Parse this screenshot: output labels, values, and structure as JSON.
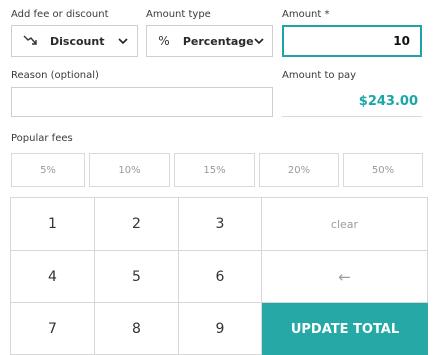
{
  "form": {
    "type_label": "Add fee or discount",
    "type_value": "Discount",
    "amount_type_label": "Amount type",
    "amount_type_value": "Percentage",
    "amount_type_symbol": "%",
    "amount_label": "Amount *",
    "amount_value": "10",
    "reason_label": "Reason (optional)",
    "reason_value": "",
    "amount_to_pay_label": "Amount to pay",
    "amount_to_pay_value": "$243.00"
  },
  "popular_fees": {
    "label": "Popular fees",
    "options": [
      "5%",
      "10%",
      "15%",
      "20%",
      "50%"
    ]
  },
  "keypad": {
    "keys": [
      "1",
      "2",
      "3",
      "4",
      "5",
      "6",
      "7",
      "8",
      "9"
    ],
    "clear_label": "clear",
    "backspace_symbol": "←",
    "update_label": "UPDATE TOTAL"
  },
  "colors": {
    "accent": "#25a8a6",
    "border": "#cfcfcf",
    "muted_text": "#9a9a9a"
  }
}
